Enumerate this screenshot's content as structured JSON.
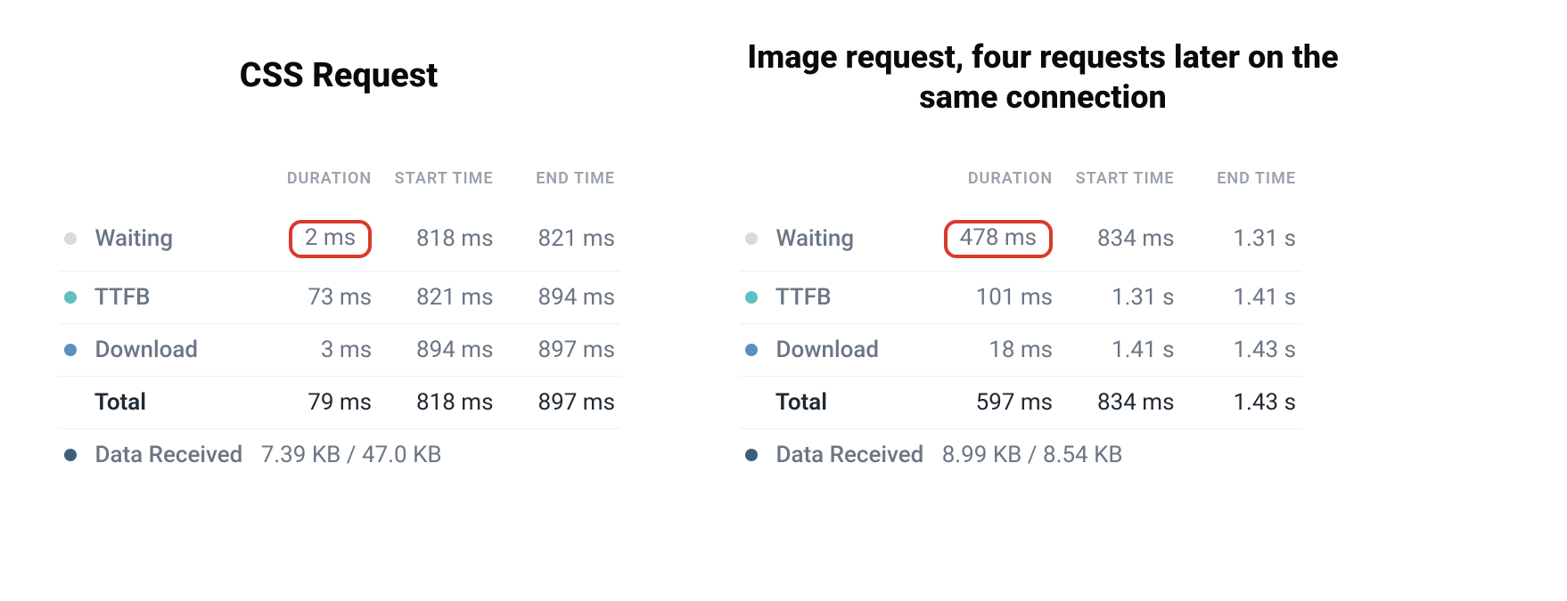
{
  "panels": {
    "left": {
      "title": "CSS Request",
      "columns": {
        "duration": "DURATION",
        "start": "START TIME",
        "end": "END TIME"
      },
      "rows": {
        "waiting": {
          "label": "Waiting",
          "duration": "2 ms",
          "start": "818 ms",
          "end": "821 ms",
          "highlight": true
        },
        "ttfb": {
          "label": "TTFB",
          "duration": "73 ms",
          "start": "821 ms",
          "end": "894 ms"
        },
        "download": {
          "label": "Download",
          "duration": "3 ms",
          "start": "894 ms",
          "end": "897 ms"
        },
        "total": {
          "label": "Total",
          "duration": "79 ms",
          "start": "818 ms",
          "end": "897 ms"
        },
        "data": {
          "label": "Data Received",
          "value": "7.39 KB / 47.0 KB"
        }
      }
    },
    "right": {
      "title": "Image request, four requests later on the same connection",
      "columns": {
        "duration": "DURATION",
        "start": "START TIME",
        "end": "END TIME"
      },
      "rows": {
        "waiting": {
          "label": "Waiting",
          "duration": "478 ms",
          "start": "834 ms",
          "end": "1.31 s",
          "highlight": true
        },
        "ttfb": {
          "label": "TTFB",
          "duration": "101 ms",
          "start": "1.31 s",
          "end": "1.41 s"
        },
        "download": {
          "label": "Download",
          "duration": "18 ms",
          "start": "1.41 s",
          "end": "1.43 s"
        },
        "total": {
          "label": "Total",
          "duration": "597 ms",
          "start": "834 ms",
          "end": "1.43 s"
        },
        "data": {
          "label": "Data Received",
          "value": "8.99 KB / 8.54 KB"
        }
      }
    }
  }
}
